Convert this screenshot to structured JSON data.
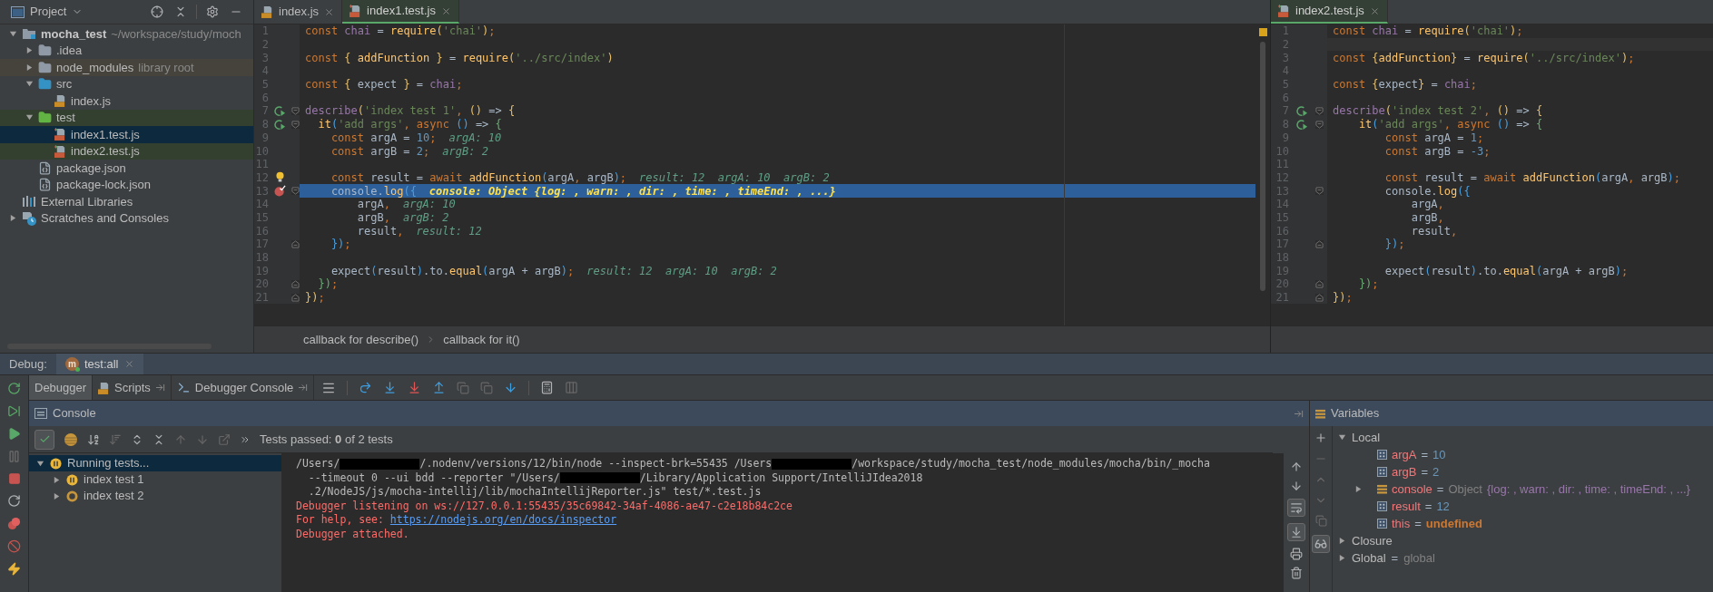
{
  "project_panel": {
    "title": "Project",
    "tree": [
      {
        "label": "mocha_test",
        "note": "~/workspace/study/moch",
        "kind": "project",
        "expanded": true,
        "selected": false,
        "children": [
          {
            "label": ".idea",
            "kind": "folder",
            "expanded": false,
            "selected": false
          },
          {
            "label": "node_modules",
            "note": "library root",
            "kind": "folder",
            "color": "#45433b",
            "expanded": false,
            "selected": false
          },
          {
            "label": "src",
            "kind": "source-folder",
            "expanded": true,
            "selected": false,
            "children": [
              {
                "label": "index.js",
                "kind": "js",
                "selected": false
              }
            ]
          },
          {
            "label": "test",
            "kind": "test-folder",
            "color": "#33402f",
            "expanded": true,
            "selected": false,
            "children": [
              {
                "label": "index1.test.js",
                "kind": "test-js",
                "selected": true
              },
              {
                "label": "index2.test.js",
                "kind": "test-js",
                "color": "#33402f",
                "selected": false
              }
            ]
          },
          {
            "label": "package.json",
            "kind": "json",
            "selected": false
          },
          {
            "label": "package-lock.json",
            "kind": "json",
            "selected": false
          }
        ]
      },
      {
        "label": "External Libraries",
        "kind": "libraries",
        "selected": false
      },
      {
        "label": "Scratches and Consoles",
        "kind": "scratches",
        "expanded": false,
        "selected": false
      }
    ]
  },
  "editors": [
    {
      "tabs": [
        {
          "label": "index.js",
          "kind": "js",
          "selected": false
        },
        {
          "label": "index1.test.js",
          "kind": "test-js",
          "selected": true
        }
      ],
      "lines": [
        {
          "n": "1",
          "segs": [
            {
              "t": "const",
              "kind": "k"
            },
            {
              "t": " chai",
              "kind": "v"
            },
            {
              "t": " = ",
              "kind": "p"
            },
            {
              "t": "require",
              "kind": "f"
            },
            {
              "t": "(",
              "kind": "b"
            },
            {
              "t": "'chai'",
              "kind": "s"
            },
            {
              "t": ")",
              "kind": "b"
            },
            {
              "t": ";",
              "kind": "k"
            }
          ]
        },
        {
          "n": "2"
        },
        {
          "n": "3",
          "segs": [
            {
              "t": "const ",
              "kind": "k"
            },
            {
              "t": "{",
              "kind": "b"
            },
            {
              "t": " addFunction ",
              "kind": "f"
            },
            {
              "t": "}",
              "kind": "b"
            },
            {
              "t": " = ",
              "kind": "p"
            },
            {
              "t": "require",
              "kind": "f"
            },
            {
              "t": "(",
              "kind": "b"
            },
            {
              "t": "'../src/index'",
              "kind": "s"
            },
            {
              "t": ")",
              "kind": "b"
            }
          ]
        },
        {
          "n": "4"
        },
        {
          "n": "5",
          "segs": [
            {
              "t": "const ",
              "kind": "k"
            },
            {
              "t": "{",
              "kind": "b"
            },
            {
              "t": " expect ",
              "kind": "p"
            },
            {
              "t": "}",
              "kind": "b"
            },
            {
              "t": " = ",
              "kind": "p"
            },
            {
              "t": "chai",
              "kind": "v"
            },
            {
              "t": ";",
              "kind": "k"
            }
          ]
        },
        {
          "n": "6"
        },
        {
          "n": "7",
          "gutter": {
            "kind": "run"
          },
          "fold": {
            "kind": "open"
          },
          "segs": [
            {
              "t": "describe",
              "kind": "v"
            },
            {
              "t": "(",
              "kind": "b"
            },
            {
              "t": "'index test 1'",
              "kind": "s"
            },
            {
              "t": ", ",
              "kind": "k"
            },
            {
              "t": "()",
              "kind": "b"
            },
            {
              "t": " => ",
              "kind": "p"
            },
            {
              "t": "{",
              "kind": "b"
            }
          ]
        },
        {
          "n": "8",
          "gutter": {
            "kind": "run"
          },
          "fold": {
            "kind": "open"
          },
          "segs": [
            {
              "t": "  it",
              "kind": "f"
            },
            {
              "t": "(",
              "kind": "c"
            },
            {
              "t": "'add args'",
              "kind": "s"
            },
            {
              "t": ", ",
              "kind": "k"
            },
            {
              "t": "async ",
              "kind": "k"
            },
            {
              "t": "()",
              "kind": "c"
            },
            {
              "t": " => ",
              "kind": "p"
            },
            {
              "t": "{",
              "kind": "g"
            }
          ]
        },
        {
          "n": "9",
          "segs": [
            {
              "t": "    const ",
              "kind": "k"
            },
            {
              "t": "argA = ",
              "kind": "p"
            },
            {
              "t": "10",
              "kind": "n"
            },
            {
              "t": ";",
              "kind": "k"
            }
          ],
          "hint": "argA: 10"
        },
        {
          "n": "10",
          "segs": [
            {
              "t": "    const ",
              "kind": "k"
            },
            {
              "t": "argB = ",
              "kind": "p"
            },
            {
              "t": "2",
              "kind": "n"
            },
            {
              "t": ";",
              "kind": "k"
            }
          ],
          "hint": "argB: 2"
        },
        {
          "n": "11"
        },
        {
          "n": "12",
          "gutter": {
            "kind": "bulb"
          },
          "segs": [
            {
              "t": "    const ",
              "kind": "k"
            },
            {
              "t": "result = ",
              "kind": "p"
            },
            {
              "t": "await ",
              "kind": "k"
            },
            {
              "t": "addFunction",
              "kind": "f"
            },
            {
              "t": "(",
              "kind": "c"
            },
            {
              "t": "argA",
              "kind": "p"
            },
            {
              "t": ", ",
              "kind": "k"
            },
            {
              "t": "argB",
              "kind": "p"
            },
            {
              "t": ")",
              "kind": "c"
            },
            {
              "t": ";",
              "kind": "k"
            }
          ],
          "hint": "result: 12  argA: 10  argB: 2"
        },
        {
          "n": "13",
          "gutter": {
            "kind": "breakpoint"
          },
          "fold": {
            "kind": "open"
          },
          "kind": "execution",
          "segs": [
            {
              "t": "    console.",
              "kind": "p"
            },
            {
              "t": "log",
              "kind": "f"
            },
            {
              "t": "(",
              "kind": "c"
            },
            {
              "t": "{",
              "kind": "c"
            }
          ],
          "hint": "console: Object {log: , warn: , dir: , time: , timeEnd: , ...}"
        },
        {
          "n": "14",
          "segs": [
            {
              "t": "        argA",
              "kind": "p"
            },
            {
              "t": ",",
              "kind": "k"
            }
          ],
          "hint": "argA: 10"
        },
        {
          "n": "15",
          "segs": [
            {
              "t": "        argB",
              "kind": "p"
            },
            {
              "t": ",",
              "kind": "k"
            }
          ],
          "hint": "argB: 2"
        },
        {
          "n": "16",
          "segs": [
            {
              "t": "        result",
              "kind": "p"
            },
            {
              "t": ",",
              "kind": "k"
            }
          ],
          "hint": "result: 12"
        },
        {
          "n": "17",
          "fold": {
            "kind": "close"
          },
          "segs": [
            {
              "t": "    })",
              "kind": "c"
            },
            {
              "t": ";",
              "kind": "k"
            }
          ]
        },
        {
          "n": "18"
        },
        {
          "n": "19",
          "segs": [
            {
              "t": "    expect",
              "kind": "p"
            },
            {
              "t": "(",
              "kind": "c"
            },
            {
              "t": "result",
              "kind": "p"
            },
            {
              "t": ")",
              "kind": "c"
            },
            {
              "t": ".to.",
              "kind": "p"
            },
            {
              "t": "equal",
              "kind": "f"
            },
            {
              "t": "(",
              "kind": "c"
            },
            {
              "t": "argA + argB",
              "kind": "p"
            },
            {
              "t": ")",
              "kind": "c"
            },
            {
              "t": ";",
              "kind": "k"
            }
          ],
          "hint": "result: 12  argA: 10  argB: 2"
        },
        {
          "n": "20",
          "fold": {
            "kind": "close"
          },
          "segs": [
            {
              "t": "  })",
              "kind": "g"
            },
            {
              "t": ";",
              "kind": "k"
            }
          ]
        },
        {
          "n": "21",
          "fold": {
            "kind": "close"
          },
          "segs": [
            {
              "t": "})",
              "kind": "b"
            },
            {
              "t": ";",
              "kind": "k"
            }
          ]
        }
      ],
      "breadcrumbs": [
        "callback for describe()",
        "callback for it()"
      ]
    },
    {
      "tabs": [
        {
          "label": "index2.test.js",
          "kind": "test-js",
          "selected": true
        }
      ],
      "lines": [
        {
          "n": "1",
          "segs": [
            {
              "t": "const",
              "kind": "k"
            },
            {
              "t": " chai",
              "kind": "v"
            },
            {
              "t": " = ",
              "kind": "p"
            },
            {
              "t": "require",
              "kind": "f"
            },
            {
              "t": "(",
              "kind": "b"
            },
            {
              "t": "'chai'",
              "kind": "s"
            },
            {
              "t": ")",
              "kind": "b"
            },
            {
              "t": ";",
              "kind": "k"
            }
          ]
        },
        {
          "n": "2",
          "kind": "caret"
        },
        {
          "n": "3",
          "segs": [
            {
              "t": "const ",
              "kind": "k"
            },
            {
              "t": "{",
              "kind": "b"
            },
            {
              "t": "addFunction",
              "kind": "f"
            },
            {
              "t": "}",
              "kind": "b"
            },
            {
              "t": " = ",
              "kind": "p"
            },
            {
              "t": "require",
              "kind": "f"
            },
            {
              "t": "(",
              "kind": "b"
            },
            {
              "t": "'../src/index'",
              "kind": "s"
            },
            {
              "t": ")",
              "kind": "b"
            },
            {
              "t": ";",
              "kind": "k"
            }
          ]
        },
        {
          "n": "4"
        },
        {
          "n": "5",
          "segs": [
            {
              "t": "const ",
              "kind": "k"
            },
            {
              "t": "{",
              "kind": "b"
            },
            {
              "t": "expect",
              "kind": "p"
            },
            {
              "t": "}",
              "kind": "b"
            },
            {
              "t": " = ",
              "kind": "p"
            },
            {
              "t": "chai",
              "kind": "v"
            },
            {
              "t": ";",
              "kind": "k"
            }
          ]
        },
        {
          "n": "6"
        },
        {
          "n": "7",
          "gutter": {
            "kind": "run"
          },
          "fold": {
            "kind": "open"
          },
          "segs": [
            {
              "t": "describe",
              "kind": "v"
            },
            {
              "t": "(",
              "kind": "b"
            },
            {
              "t": "'index test 2'",
              "kind": "s"
            },
            {
              "t": ", ",
              "kind": "k"
            },
            {
              "t": "()",
              "kind": "b"
            },
            {
              "t": " => ",
              "kind": "p"
            },
            {
              "t": "{",
              "kind": "b"
            }
          ]
        },
        {
          "n": "8",
          "gutter": {
            "kind": "run"
          },
          "fold": {
            "kind": "open"
          },
          "segs": [
            {
              "t": "    it",
              "kind": "f"
            },
            {
              "t": "(",
              "kind": "c"
            },
            {
              "t": "'add args'",
              "kind": "s"
            },
            {
              "t": ", ",
              "kind": "k"
            },
            {
              "t": "async ",
              "kind": "k"
            },
            {
              "t": "()",
              "kind": "c"
            },
            {
              "t": " => ",
              "kind": "p"
            },
            {
              "t": "{",
              "kind": "g"
            }
          ]
        },
        {
          "n": "9",
          "segs": [
            {
              "t": "        const ",
              "kind": "k"
            },
            {
              "t": "argA = ",
              "kind": "p"
            },
            {
              "t": "1",
              "kind": "n"
            },
            {
              "t": ";",
              "kind": "k"
            }
          ]
        },
        {
          "n": "10",
          "segs": [
            {
              "t": "        const ",
              "kind": "k"
            },
            {
              "t": "argB = ",
              "kind": "p"
            },
            {
              "t": "-3",
              "kind": "n"
            },
            {
              "t": ";",
              "kind": "k"
            }
          ]
        },
        {
          "n": "11"
        },
        {
          "n": "12",
          "segs": [
            {
              "t": "        const ",
              "kind": "k"
            },
            {
              "t": "result = ",
              "kind": "p"
            },
            {
              "t": "await ",
              "kind": "k"
            },
            {
              "t": "addFunction",
              "kind": "f"
            },
            {
              "t": "(",
              "kind": "c"
            },
            {
              "t": "argA",
              "kind": "p"
            },
            {
              "t": ", ",
              "kind": "k"
            },
            {
              "t": "argB",
              "kind": "p"
            },
            {
              "t": ")",
              "kind": "c"
            },
            {
              "t": ";",
              "kind": "k"
            }
          ]
        },
        {
          "n": "13",
          "fold": {
            "kind": "open"
          },
          "segs": [
            {
              "t": "        console.",
              "kind": "p"
            },
            {
              "t": "log",
              "kind": "f"
            },
            {
              "t": "(",
              "kind": "c"
            },
            {
              "t": "{",
              "kind": "c"
            }
          ]
        },
        {
          "n": "14",
          "segs": [
            {
              "t": "            argA",
              "kind": "p"
            },
            {
              "t": ",",
              "kind": "k"
            }
          ]
        },
        {
          "n": "15",
          "segs": [
            {
              "t": "            argB",
              "kind": "p"
            },
            {
              "t": ",",
              "kind": "k"
            }
          ]
        },
        {
          "n": "16",
          "segs": [
            {
              "t": "            result",
              "kind": "p"
            },
            {
              "t": ",",
              "kind": "k"
            }
          ]
        },
        {
          "n": "17",
          "fold": {
            "kind": "close"
          },
          "segs": [
            {
              "t": "        })",
              "kind": "c"
            },
            {
              "t": ";",
              "kind": "k"
            }
          ]
        },
        {
          "n": "18"
        },
        {
          "n": "19",
          "segs": [
            {
              "t": "        expect",
              "kind": "p"
            },
            {
              "t": "(",
              "kind": "c"
            },
            {
              "t": "result",
              "kind": "p"
            },
            {
              "t": ")",
              "kind": "c"
            },
            {
              "t": ".to.",
              "kind": "p"
            },
            {
              "t": "equal",
              "kind": "f"
            },
            {
              "t": "(",
              "kind": "c"
            },
            {
              "t": "argA + argB",
              "kind": "p"
            },
            {
              "t": ")",
              "kind": "c"
            },
            {
              "t": ";",
              "kind": "k"
            }
          ]
        },
        {
          "n": "20",
          "fold": {
            "kind": "close"
          },
          "segs": [
            {
              "t": "    })",
              "kind": "g"
            },
            {
              "t": ";",
              "kind": "k"
            }
          ]
        },
        {
          "n": "21",
          "fold": {
            "kind": "close"
          },
          "segs": [
            {
              "t": "})",
              "kind": "b"
            },
            {
              "t": ";",
              "kind": "k"
            }
          ]
        }
      ]
    }
  ],
  "debug": {
    "label": "Debug:",
    "session_tab": {
      "badge": "m",
      "label": "test:all"
    },
    "view_tabs": [
      {
        "label": "Debugger",
        "kind": "plain",
        "selected": true
      },
      {
        "label": "Scripts",
        "kind": "scripts",
        "selected": false
      },
      {
        "label": "Debugger Console",
        "kind": "console",
        "selected": false
      }
    ],
    "console_title": "Console",
    "variables_title": "Variables",
    "test_status": "Tests passed: **0** of 2 tests",
    "test_tree": [
      {
        "label": "Running tests...",
        "kind": "paused",
        "expanded": true,
        "selected": true,
        "children": [
          {
            "label": "index test 1",
            "kind": "paused",
            "expanded": false,
            "selected": false
          },
          {
            "label": "index test 2",
            "kind": "pending",
            "expanded": false,
            "selected": false
          }
        ]
      }
    ],
    "console_lines": [
      {
        "kind": "stdout",
        "segs": [
          {
            "kind": "text",
            "t": "/Users/"
          },
          {
            "kind": "redacted"
          },
          {
            "kind": "text",
            "t": "/.nodenv/versions/12/bin/node --inspect-brk=55435 /Users"
          },
          {
            "kind": "redacted"
          },
          {
            "kind": "text",
            "t": "/workspace/study/mocha_test/node_modules/mocha/bin/_mocha"
          }
        ]
      },
      {
        "kind": "stdout",
        "segs": [
          {
            "kind": "text",
            "t": "  --timeout 0 --ui bdd --reporter \"/Users/"
          },
          {
            "kind": "redacted"
          },
          {
            "kind": "text",
            "t": "/Library/Application Support/IntelliJIdea2018"
          }
        ]
      },
      {
        "kind": "stdout",
        "segs": [
          {
            "kind": "text",
            "t": "  .2/NodeJS/js/mocha-intellij/lib/mochaIntellijReporter.js\" test/*.test.js"
          }
        ]
      },
      {
        "kind": "stderr",
        "segs": [
          {
            "kind": "text",
            "t": "Debugger listening on ws://127.0.0.1:55435/35c69842-34af-4086-ae47-c2e18b84c2ce"
          }
        ]
      },
      {
        "kind": "stderr",
        "segs": [
          {
            "kind": "text",
            "t": "For help, see: "
          },
          {
            "kind": "link",
            "t": "https://nodejs.org/en/docs/inspector"
          }
        ]
      },
      {
        "kind": "stderr",
        "segs": [
          {
            "kind": "text",
            "t": "Debugger attached."
          }
        ]
      }
    ],
    "variables": [
      {
        "label": "Local",
        "expanded": true,
        "children": [
          {
            "name": "argA",
            "eq": "=",
            "value": "10",
            "kind": "number"
          },
          {
            "name": "argB",
            "eq": "=",
            "value": "2",
            "kind": "number"
          },
          {
            "name": "console",
            "eq": "=",
            "type": "Object",
            "value": "{log: , warn: , dir: , time: , timeEnd: , ...}",
            "kind": "object",
            "expanded": false
          },
          {
            "name": "result",
            "eq": "=",
            "value": "12",
            "kind": "number"
          },
          {
            "name": "this",
            "eq": "=",
            "value": "undefined",
            "kind": "undefined"
          }
        ]
      },
      {
        "label": "Closure",
        "expanded": false
      },
      {
        "label": "Global",
        "eq": "=",
        "value": "global",
        "expanded": false
      }
    ]
  }
}
